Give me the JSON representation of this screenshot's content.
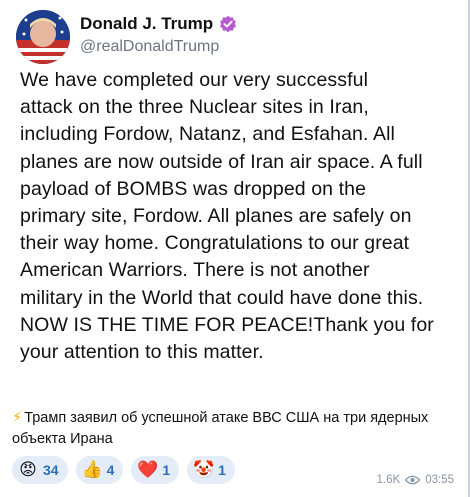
{
  "post": {
    "display_name": "Donald J. Trump",
    "handle": "@realDonaldTrump",
    "text": "We have completed our very successful\nattack on the three Nuclear sites in Iran,\nincluding Fordow, Natanz, and Esfahan. All\nplanes are now outside of Iran air space. A full\npayload of BOMBS was dropped on the\nprimary site, Fordow. All planes are safely on\ntheir way home. Congratulations to our great\nAmerican Warriors. There is not another\nmilitary in the World that could have done this.\nNOW IS THE TIME FOR PEACE!Thank you for\nyour attention to this matter."
  },
  "message": {
    "bolt_icon": "⚡",
    "caption": "Трамп заявил об успешной атаке ВВС США на три ядерных объекта Ирана"
  },
  "reactions": [
    {
      "emoji": "😡",
      "count": "34"
    },
    {
      "emoji": "👍",
      "count": "4"
    },
    {
      "emoji": "❤️",
      "count": "1"
    },
    {
      "emoji": "🤡",
      "count": "1"
    }
  ],
  "meta": {
    "views": "1.6K",
    "time": "03:55"
  },
  "colors": {
    "verified": "#b45ccf",
    "reaction_bg": "#e4edf7",
    "reaction_text": "#2e6db5"
  }
}
